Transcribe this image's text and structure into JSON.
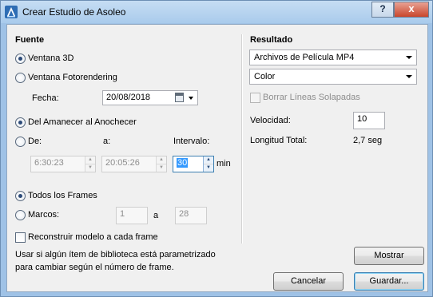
{
  "window": {
    "title": "Crear Estudio de Asoleo",
    "help_label": "?",
    "close_label": "x"
  },
  "fuente": {
    "heading": "Fuente",
    "ventana3d_label": "Ventana 3D",
    "fotorender_label": "Ventana Fotorendering",
    "fecha_label": "Fecha:",
    "fecha_value": "20/08/2018"
  },
  "timing": {
    "dawn_dusk_label": "Del Amanecer al Anochecer",
    "de_label": "De:",
    "a_label": "a:",
    "intervalo_label": "Intervalo:",
    "start_time": "6:30:23",
    "end_time": "20:05:26",
    "interval_value": "30",
    "min_label": "min"
  },
  "frames": {
    "all_label": "Todos los Frames",
    "marcos_label": "Marcos:",
    "from_value": "1",
    "a_label": "a",
    "to_value": "28",
    "rebuild_label": "Reconstruir modelo a cada frame"
  },
  "description": "Usar si algún ítem de biblioteca está parametrizado para cambiar según el número de frame.",
  "resultado": {
    "heading": "Resultado",
    "format_value": "Archivos de Película MP4",
    "color_value": "Color",
    "borrar_label": "Borrar Líneas Solapadas",
    "velocidad_label": "Velocidad:",
    "velocidad_value": "10",
    "longitud_label": "Longitud Total:",
    "longitud_value": "2,7 seg"
  },
  "buttons": {
    "mostrar": "Mostrar",
    "cancelar": "Cancelar",
    "guardar": "Guardar..."
  }
}
